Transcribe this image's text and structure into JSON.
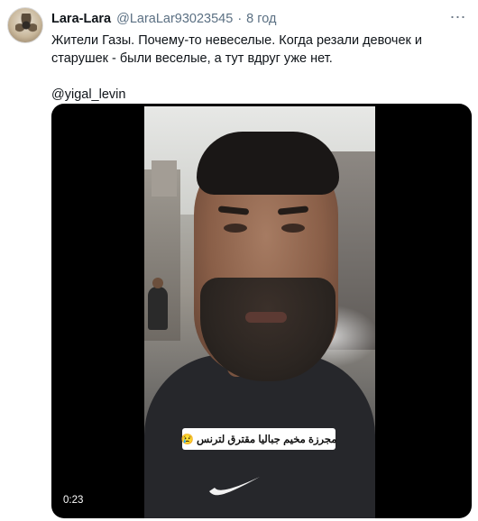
{
  "tweet": {
    "author_name": "Lara-Lara",
    "author_handle": "@LaraLar93023545",
    "separator": "·",
    "timestamp": "8 год",
    "text_line": "Жители Газы. Почему-то невеселые. Когда резали девочек и старушек - были веселые, а тут вдруг уже нет.",
    "mention": "@yigal_levin",
    "more_icon": "⋯"
  },
  "media": {
    "caption": "مجرزة مخيم جباليا مقترق لترنس 😢",
    "duration": "0:23"
  },
  "icons": {
    "avatar": "avatar-image",
    "more": "more-options-icon",
    "swoosh": "nike-swoosh-icon"
  },
  "colors": {
    "secondary_text": "#5b7083",
    "media_background": "#000000"
  }
}
